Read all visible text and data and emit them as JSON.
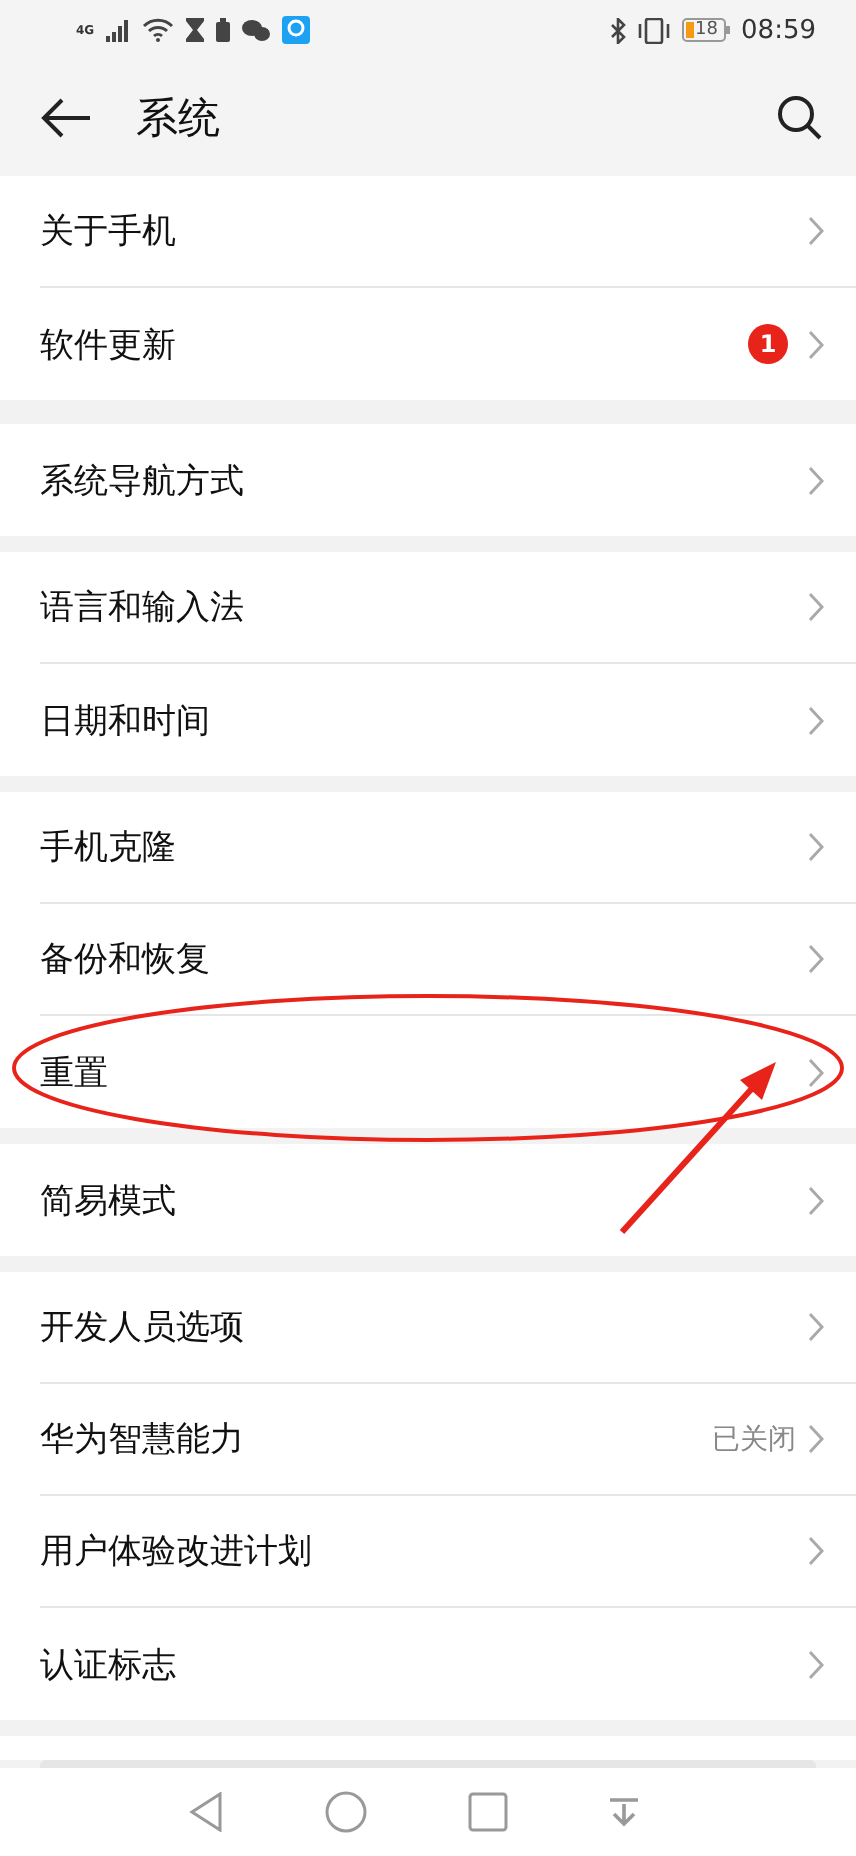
{
  "status_bar": {
    "network": "4G",
    "battery": "18",
    "time": "08:59"
  },
  "header": {
    "title": "系统"
  },
  "groups": [
    {
      "items": [
        {
          "label": "关于手机",
          "highlighted": false
        },
        {
          "label": "软件更新",
          "badge": "1",
          "highlighted": false
        }
      ]
    },
    {
      "items": [
        {
          "label": "系统导航方式",
          "highlighted": false
        }
      ]
    },
    {
      "items": [
        {
          "label": "语言和输入法",
          "highlighted": false
        },
        {
          "label": "日期和时间",
          "highlighted": false
        }
      ]
    },
    {
      "items": [
        {
          "label": "手机克隆",
          "highlighted": false
        },
        {
          "label": "备份和恢复",
          "highlighted": false
        },
        {
          "label": "重置",
          "highlighted": true
        }
      ]
    },
    {
      "items": [
        {
          "label": "简易模式",
          "highlighted": false
        }
      ]
    },
    {
      "items": [
        {
          "label": "开发人员选项",
          "highlighted": false
        },
        {
          "label": "华为智慧能力",
          "value": "已关闭",
          "highlighted": false
        },
        {
          "label": "用户体验改进计划",
          "highlighted": false
        },
        {
          "label": "认证标志",
          "highlighted": false
        }
      ]
    }
  ]
}
